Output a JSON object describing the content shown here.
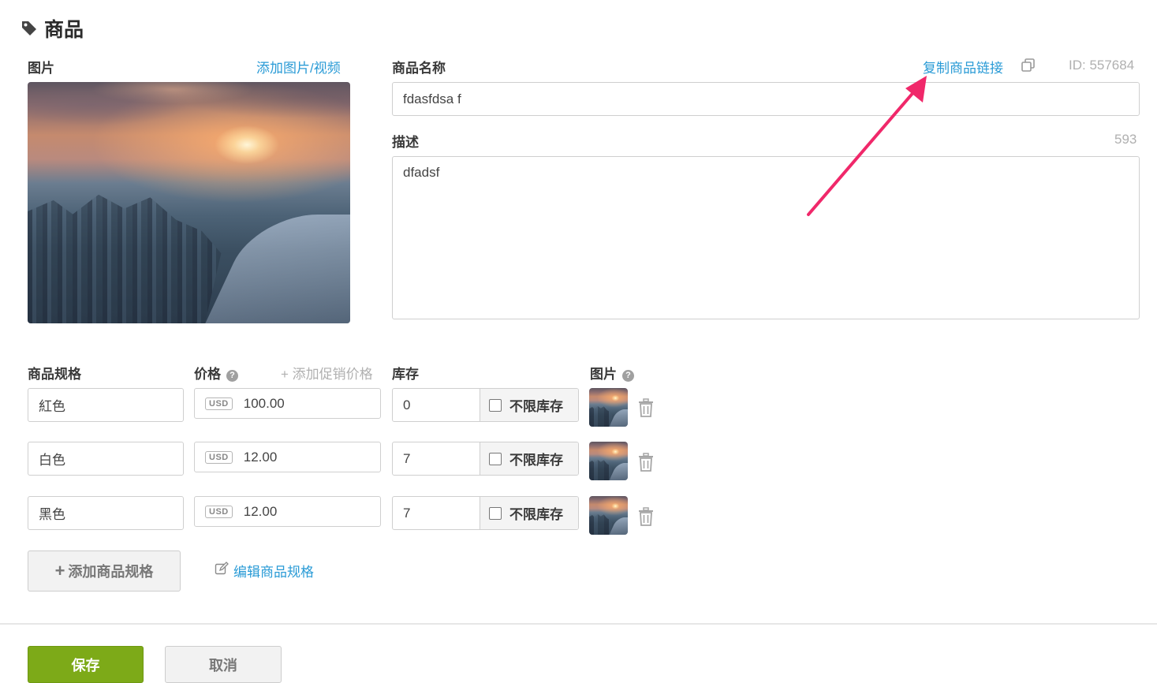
{
  "section": {
    "title": "商品",
    "icon": "tag-icon"
  },
  "image_panel": {
    "label": "图片",
    "add_link": "添加图片/视频"
  },
  "product": {
    "name_label": "商品名称",
    "copy_link": "复制商品链接",
    "copy_icon": "copy-icon",
    "id_text": "ID: 557684",
    "name_value": "fdasfdsa f",
    "desc_label": "描述",
    "desc_counter": "593",
    "desc_value": "dfadsf"
  },
  "variants": {
    "headers": {
      "spec": "商品规格",
      "price": "价格",
      "add_promo": "+ 添加促销价格",
      "stock": "库存",
      "image": "图片"
    },
    "rows": [
      {
        "spec": "紅色",
        "currency": "USD",
        "price": "100.00",
        "stock": "0",
        "unlimited_label": "不限库存",
        "unlimited_checked": false
      },
      {
        "spec": "白色",
        "currency": "USD",
        "price": "12.00",
        "stock": "7",
        "unlimited_label": "不限库存",
        "unlimited_checked": false
      },
      {
        "spec": "黑色",
        "currency": "USD",
        "price": "12.00",
        "stock": "7",
        "unlimited_label": "不限库存",
        "unlimited_checked": false
      }
    ],
    "add_button": "添加商品规格",
    "edit_link": "编辑商品规格"
  },
  "footer": {
    "save": "保存",
    "cancel": "取消"
  },
  "colors": {
    "link": "#2a9bd6",
    "save": "#7daa18",
    "annotation_arrow": "#f0286a"
  }
}
